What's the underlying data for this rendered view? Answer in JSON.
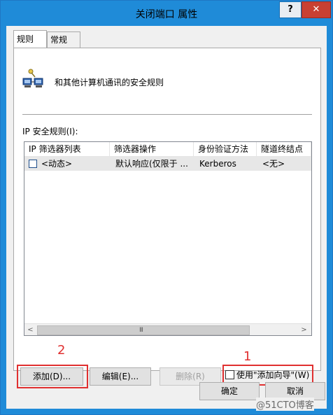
{
  "window": {
    "title": "关闭端口 属性",
    "help_label": "?",
    "close_label": "✕"
  },
  "tabs": [
    {
      "label": "规则"
    },
    {
      "label": "常规"
    }
  ],
  "description": "和其他计算机通讯的安全规则",
  "ip_rules_label": "IP 安全规则(I):",
  "list": {
    "columns": [
      "IP 筛选器列表",
      "筛选器操作",
      "身份验证方法",
      "隧道终结点"
    ],
    "rows": [
      {
        "checked": false,
        "filter_list": "<动态>",
        "action": "默认响应(仅限于 ...",
        "auth": "Kerberos",
        "tunnel": "<无>"
      }
    ]
  },
  "scrollbar": {
    "left_arrow": "<",
    "right_arrow": ">",
    "grip": "III"
  },
  "buttons": {
    "add": "添加(D)...",
    "edit": "编辑(E)...",
    "delete": "删除(R)",
    "ok": "确定",
    "cancel": "取消"
  },
  "wizard_checkbox": {
    "label": "使用\"添加向导\"(W)",
    "checked": false
  },
  "annotations": {
    "marker_1": "1",
    "marker_2": "2"
  },
  "watermark": "@51CTO博客",
  "colors": {
    "titlebar": "#1f8bd8",
    "close": "#c84032",
    "annotation": "#e03030"
  }
}
